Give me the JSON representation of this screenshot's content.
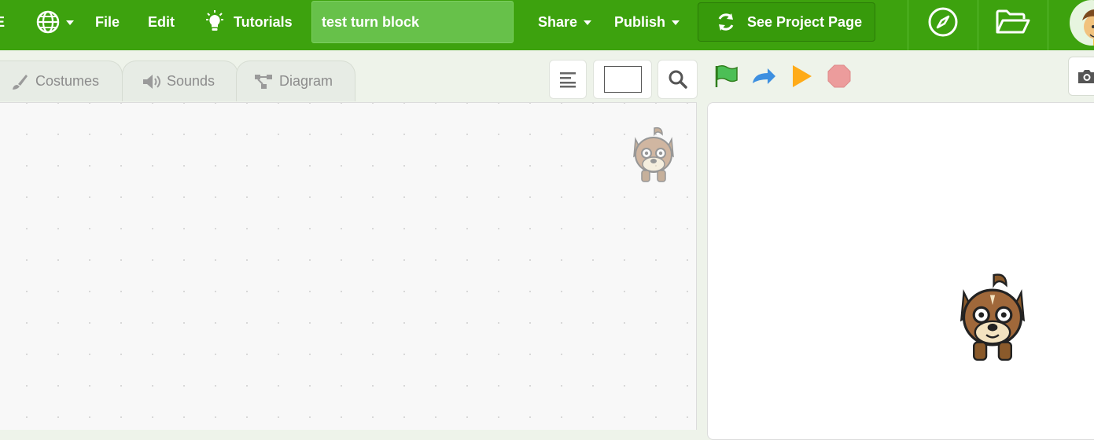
{
  "menubar": {
    "logo_fragment": "E",
    "language_icon": "globe-icon",
    "file_label": "File",
    "edit_label": "Edit",
    "tutorials_label": "Tutorials",
    "project_title": "test turn block",
    "share_label": "Share",
    "publish_label": "Publish",
    "see_project_label": "See Project Page",
    "explore_icon": "compass-icon",
    "my_stuff_icon": "folder-open-icon",
    "accent_color": "#3da20e"
  },
  "tabs": [
    {
      "label": "Costumes",
      "icon": "brush-icon"
    },
    {
      "label": "Sounds",
      "icon": "speaker-icon"
    },
    {
      "label": "Diagram",
      "icon": "diagram-icon"
    }
  ],
  "toolbar": {
    "align_icon": "align-left-icon",
    "search_icon": "search-icon"
  },
  "controls": {
    "green_flag_icon": "green-flag-icon",
    "step_icon": "redo-arrow-icon",
    "play_icon": "play-icon",
    "stop_icon": "stop-icon",
    "screenshot_icon": "camera-icon"
  },
  "sprite": {
    "name_icon": "dog-sprite"
  }
}
